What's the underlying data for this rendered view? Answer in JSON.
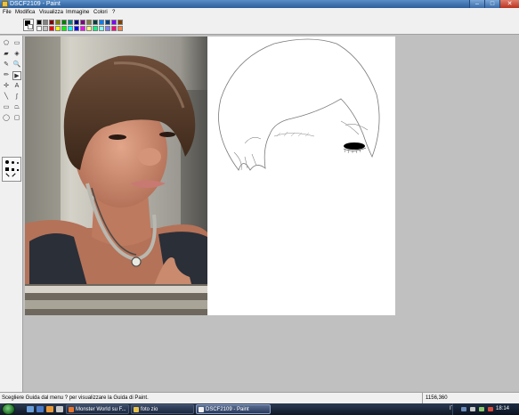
{
  "window": {
    "title": "DSCF2109 - Paint",
    "minimize_glyph": "–",
    "maximize_glyph": "□",
    "close_glyph": "✕"
  },
  "menu": [
    {
      "key": "file",
      "label": "File"
    },
    {
      "key": "modifica",
      "label": "Modifica"
    },
    {
      "key": "visualizza",
      "label": "Visualizza"
    },
    {
      "key": "immagine",
      "label": "Immagine"
    },
    {
      "key": "colori",
      "label": "Colori"
    },
    {
      "key": "help",
      "label": "?"
    }
  ],
  "palette": {
    "foreground": "#000000",
    "background": "#ffffff",
    "top_row": [
      "#000000",
      "#808080",
      "#800000",
      "#808000",
      "#008000",
      "#008080",
      "#000080",
      "#800080",
      "#808040",
      "#004040",
      "#0080ff",
      "#004080",
      "#8000ff",
      "#804000"
    ],
    "bottom_row": [
      "#ffffff",
      "#c0c0c0",
      "#ff0000",
      "#ffff00",
      "#00ff00",
      "#00ffff",
      "#0000ff",
      "#ff00ff",
      "#ffff80",
      "#00ff80",
      "#80ffff",
      "#8080ff",
      "#ff0080",
      "#ff8040"
    ]
  },
  "tools": [
    {
      "name": "free-select-tool",
      "icon": "free-select-icon",
      "glyph": "⬠"
    },
    {
      "name": "rect-select-tool",
      "icon": "rect-select-icon",
      "glyph": "▭"
    },
    {
      "name": "eraser-tool",
      "icon": "eraser-icon",
      "glyph": "▰"
    },
    {
      "name": "fill-tool",
      "icon": "fill-bucket-icon",
      "glyph": "◈"
    },
    {
      "name": "color-picker-tool",
      "icon": "eyedropper-icon",
      "glyph": "✎"
    },
    {
      "name": "magnifier-tool",
      "icon": "magnifier-icon",
      "glyph": "🔍"
    },
    {
      "name": "pencil-tool",
      "icon": "pencil-icon",
      "glyph": "✏"
    },
    {
      "name": "brush-tool",
      "icon": "brush-icon",
      "glyph": "▶",
      "selected": true
    },
    {
      "name": "airbrush-tool",
      "icon": "airbrush-icon",
      "glyph": "✢"
    },
    {
      "name": "text-tool",
      "icon": "text-icon",
      "glyph": "A"
    },
    {
      "name": "line-tool",
      "icon": "line-icon",
      "glyph": "╲"
    },
    {
      "name": "curve-tool",
      "icon": "curve-icon",
      "glyph": "∫"
    },
    {
      "name": "rectangle-tool",
      "icon": "rectangle-icon",
      "glyph": "▭"
    },
    {
      "name": "polygon-tool",
      "icon": "polygon-icon",
      "glyph": "⏢"
    },
    {
      "name": "ellipse-tool",
      "icon": "ellipse-icon",
      "glyph": "◯"
    },
    {
      "name": "rounded-rect-tool",
      "icon": "rounded-rect-icon",
      "glyph": "▢"
    }
  ],
  "status": {
    "text": "Scegliere Guida dal menu ? per visualizzare la Guida di Paint.",
    "coordinates": "1156,360"
  },
  "taskbar": {
    "buttons": [
      {
        "label": "Monster World su F...",
        "icon_color": "#e8742a",
        "active": false
      },
      {
        "label": "foto zio",
        "icon_color": "#e8c24a",
        "active": false
      },
      {
        "label": "DSCF2109 - Paint",
        "icon_color": "#f0f0f0",
        "active": true
      }
    ],
    "language": "IT",
    "clock": "18:14"
  }
}
